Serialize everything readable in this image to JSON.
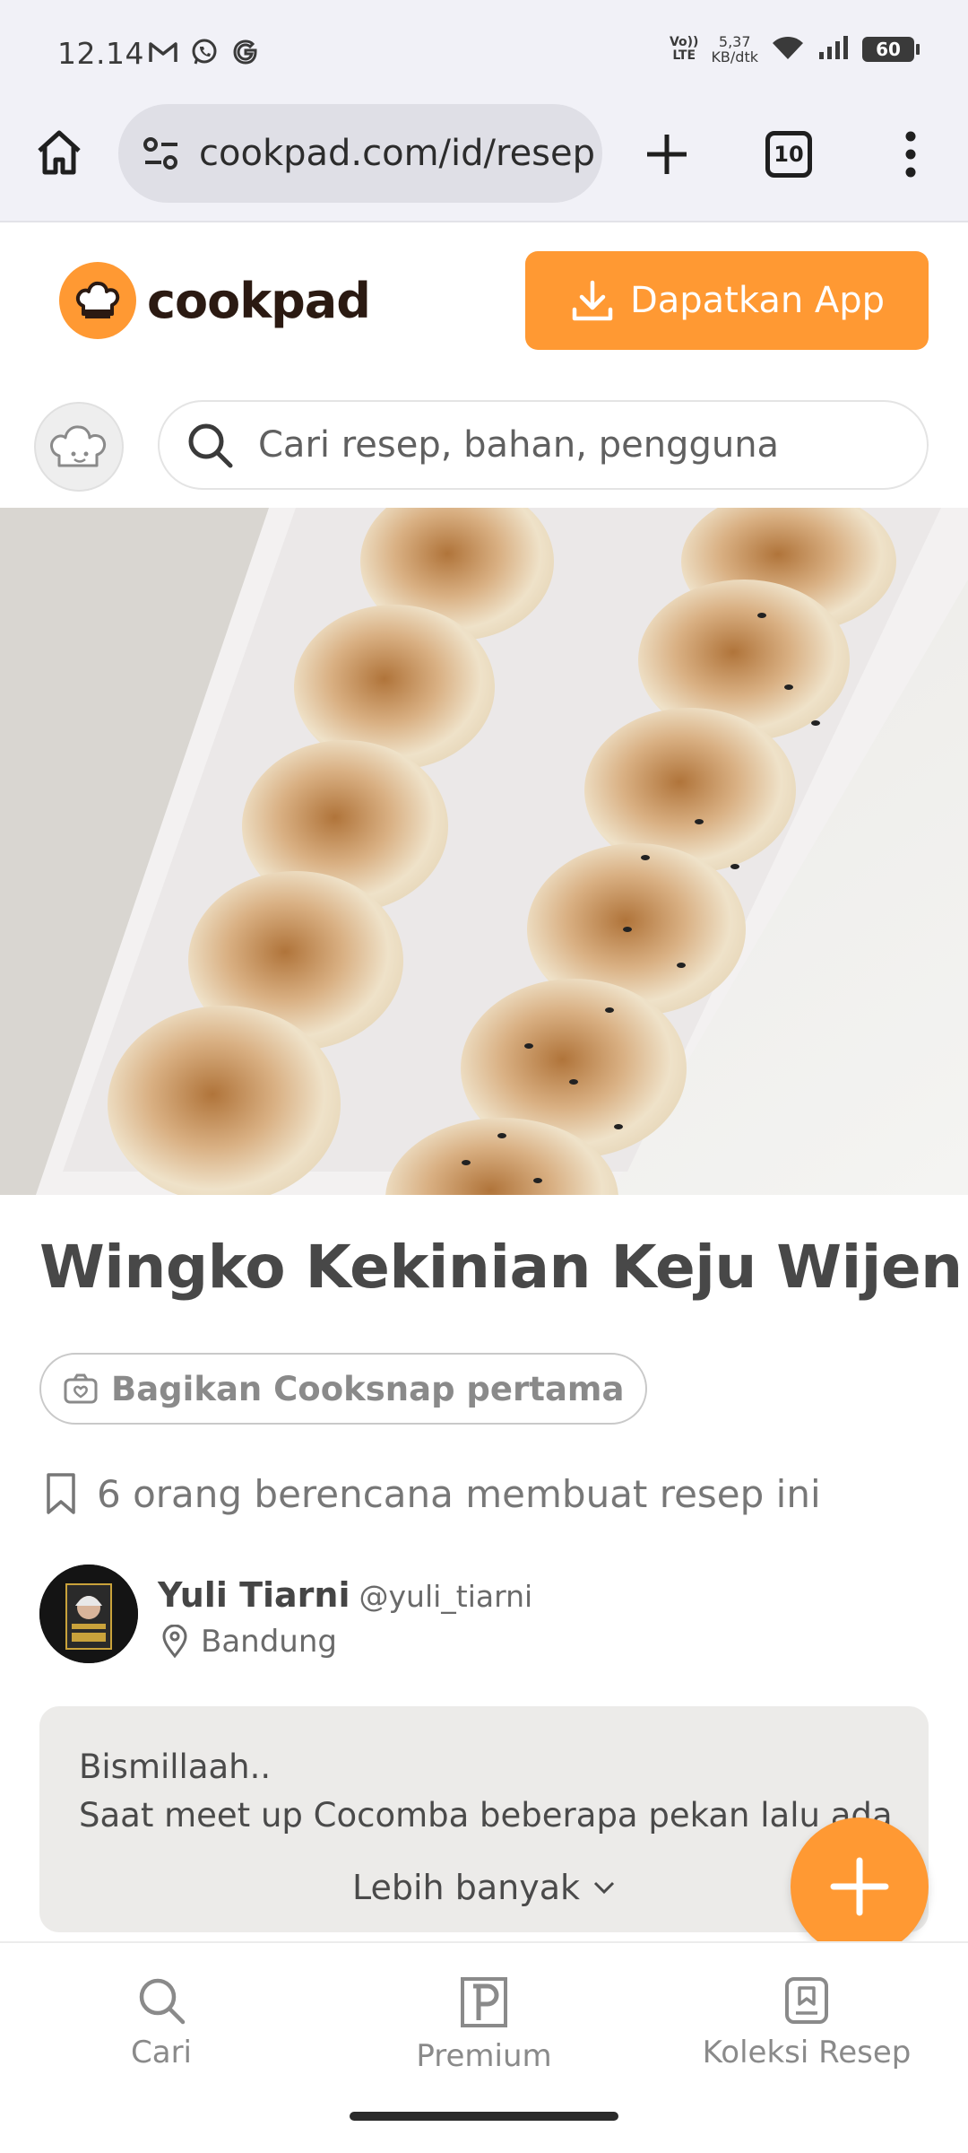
{
  "status_bar": {
    "time": "12.14",
    "volte_line1": "Vo))",
    "volte_line2": "LTE",
    "net_speed_value": "5,37",
    "net_speed_unit": "KB/dtk",
    "battery": "60",
    "notification_icons": [
      "gmail-icon",
      "whatsapp-icon",
      "google-icon"
    ]
  },
  "browser": {
    "url": "cookpad.com/id/resep",
    "tab_count": "10"
  },
  "site": {
    "logo_text": "cookpad",
    "get_app_label": "Dapatkan App",
    "search_placeholder": "Cari resep, bahan, pengguna"
  },
  "recipe": {
    "title": "Wingko Kekinian Keju Wijen",
    "cooksnap_label": "Bagikan Cooksnap pertama",
    "plans_text": "6 orang berencana membuat resep ini",
    "author": {
      "name": "Yuli Tiarni",
      "handle": "@yuli_tiarni",
      "location": "Bandung"
    },
    "story_line1": "Bismillaah..",
    "story_line2": "Saat meet up Cocomba beberapa pekan lalu ada",
    "more_label": "Lebih banyak"
  },
  "bottom_nav": {
    "items": [
      {
        "label": "Cari",
        "icon": "search-icon"
      },
      {
        "label": "Premium",
        "icon": "premium-icon"
      },
      {
        "label": "Koleksi Resep",
        "icon": "collection-icon"
      }
    ]
  },
  "colors": {
    "accent": "#ff9933",
    "logo_text": "#2b1a12",
    "browser_bar": "#f1f1f7"
  }
}
